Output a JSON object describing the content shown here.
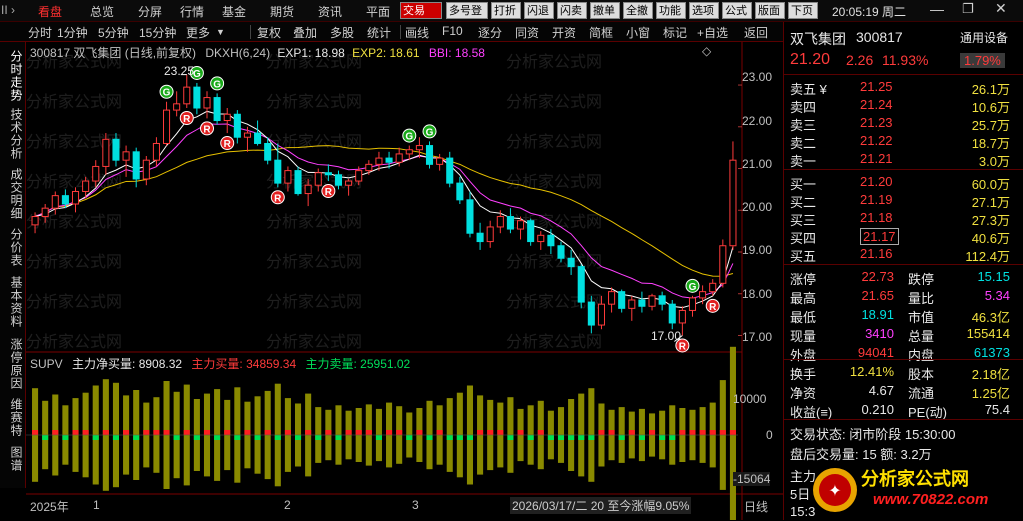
{
  "menubar": {
    "items": [
      "看盘",
      "总览",
      "分屏",
      "行情",
      "基金",
      "期货",
      "资讯",
      "平面"
    ],
    "active_index": 0,
    "partial_left": "II ›",
    "buttons": [
      "交易",
      "多号登",
      "打折",
      "闪退",
      "闪卖",
      "撤单",
      "全撤",
      "功能",
      "选项",
      "公式",
      "版面",
      "下页"
    ],
    "clock": "20:05:19 周二"
  },
  "toolbar": {
    "periods": [
      "分时",
      "1分钟",
      "5分钟",
      "15分钟",
      "更多"
    ],
    "actions": [
      "复权",
      "叠加",
      "多股",
      "统计",
      "画线",
      "F10",
      "逐分",
      "同资",
      "开资",
      "简框",
      "小窗",
      "标记",
      "+自选",
      "返回"
    ]
  },
  "leftnav": [
    "分时走势",
    "技术分析",
    "成交明细",
    "分价表",
    "基本资料",
    "涨停原因",
    "维赛特",
    "图谱"
  ],
  "legend_main": {
    "code_name": "300817 双飞集团 (日线,前复权)",
    "indicator": "DKXH(6,24)",
    "exp1": "EXP1: 18.98",
    "exp2": "EXP2: 18.61",
    "bbi": "BBI: 18.58"
  },
  "legend_sub": {
    "name": "SUPV",
    "net": "主力净买量: 8908.32",
    "buy": "主力买量: 34859.34",
    "sell": "主力卖量: 25951.02"
  },
  "annotations": {
    "high": "23.25",
    "low": "17.00"
  },
  "xaxis": {
    "labels": [
      "2025年",
      "1",
      "2",
      "3"
    ],
    "cursor_date": "2026/03/17/二",
    "range_text": "20 至今涨幅9.05%",
    "cycle": "日线"
  },
  "right_axis_main": [
    "23.00",
    "22.00",
    "21.00",
    "20.00",
    "19.00",
    "18.00",
    "17.00"
  ],
  "right_axis_sub": [
    "10000",
    "0",
    "-15064"
  ],
  "chart_data": {
    "type": "candlestick",
    "ylim": [
      16.7,
      23.6
    ],
    "ohlc": [
      [
        19.65,
        19.95,
        19.45,
        19.85
      ],
      [
        19.85,
        20.15,
        19.7,
        20.05
      ],
      [
        20.05,
        20.45,
        19.9,
        20.35
      ],
      [
        20.35,
        20.5,
        20.05,
        20.15
      ],
      [
        20.15,
        20.55,
        19.95,
        20.45
      ],
      [
        20.45,
        20.8,
        20.3,
        20.7
      ],
      [
        20.7,
        21.2,
        20.55,
        21.05
      ],
      [
        21.05,
        21.85,
        20.85,
        21.7
      ],
      [
        21.7,
        21.85,
        21.05,
        21.2
      ],
      [
        21.2,
        21.55,
        20.8,
        21.4
      ],
      [
        21.4,
        21.5,
        20.55,
        20.75
      ],
      [
        20.75,
        21.3,
        20.6,
        21.2
      ],
      [
        21.2,
        21.75,
        21.05,
        21.6
      ],
      [
        21.6,
        22.6,
        21.55,
        22.4
      ],
      [
        22.4,
        22.85,
        22.25,
        22.55
      ],
      [
        22.55,
        23.25,
        22.45,
        22.95
      ],
      [
        22.95,
        23.05,
        22.3,
        22.45
      ],
      [
        22.45,
        22.85,
        22.2,
        22.7
      ],
      [
        22.7,
        22.8,
        22.05,
        22.15
      ],
      [
        22.15,
        22.45,
        21.85,
        22.3
      ],
      [
        22.3,
        22.4,
        21.6,
        21.75
      ],
      [
        21.75,
        22.0,
        21.4,
        21.85
      ],
      [
        21.85,
        22.15,
        21.55,
        21.6
      ],
      [
        21.6,
        21.75,
        21.1,
        21.2
      ],
      [
        21.2,
        21.6,
        20.55,
        20.65
      ],
      [
        20.65,
        21.05,
        20.45,
        20.95
      ],
      [
        20.95,
        21.05,
        20.35,
        20.4
      ],
      [
        20.4,
        20.75,
        20.1,
        20.6
      ],
      [
        20.6,
        21.0,
        20.45,
        20.9
      ],
      [
        20.9,
        21.1,
        20.7,
        20.85
      ],
      [
        20.85,
        20.95,
        20.5,
        20.6
      ],
      [
        20.6,
        20.75,
        20.35,
        20.7
      ],
      [
        20.7,
        21.05,
        20.6,
        20.95
      ],
      [
        20.95,
        21.2,
        20.85,
        21.1
      ],
      [
        21.1,
        21.4,
        20.95,
        21.25
      ],
      [
        21.25,
        21.4,
        21.0,
        21.15
      ],
      [
        21.15,
        21.5,
        21.05,
        21.35
      ],
      [
        21.35,
        21.55,
        21.2,
        21.45
      ],
      [
        21.45,
        21.75,
        21.25,
        21.55
      ],
      [
        21.55,
        21.65,
        21.0,
        21.1
      ],
      [
        21.1,
        21.35,
        20.95,
        21.25
      ],
      [
        21.25,
        21.4,
        20.55,
        20.65
      ],
      [
        20.65,
        20.8,
        20.15,
        20.25
      ],
      [
        20.25,
        20.45,
        19.35,
        19.45
      ],
      [
        19.45,
        19.7,
        19.05,
        19.25
      ],
      [
        19.25,
        19.75,
        19.1,
        19.6
      ],
      [
        19.6,
        20.0,
        19.45,
        19.85
      ],
      [
        19.85,
        20.05,
        19.45,
        19.55
      ],
      [
        19.55,
        19.85,
        19.3,
        19.75
      ],
      [
        19.75,
        19.8,
        19.15,
        19.25
      ],
      [
        19.25,
        19.5,
        19.05,
        19.4
      ],
      [
        19.4,
        19.55,
        18.95,
        19.15
      ],
      [
        19.15,
        19.25,
        18.75,
        18.85
      ],
      [
        18.85,
        19.05,
        18.45,
        18.65
      ],
      [
        18.65,
        18.7,
        17.65,
        17.8
      ],
      [
        17.8,
        17.95,
        17.05,
        17.25
      ],
      [
        17.25,
        17.95,
        17.15,
        17.75
      ],
      [
        17.75,
        18.15,
        17.55,
        18.05
      ],
      [
        18.05,
        18.1,
        17.55,
        17.65
      ],
      [
        17.65,
        17.95,
        17.35,
        17.85
      ],
      [
        17.85,
        18.05,
        17.55,
        17.7
      ],
      [
        17.7,
        18.0,
        17.6,
        17.95
      ],
      [
        17.95,
        18.05,
        17.6,
        17.75
      ],
      [
        17.75,
        17.85,
        17.15,
        17.3
      ],
      [
        17.3,
        17.7,
        17.0,
        17.6
      ],
      [
        17.6,
        17.95,
        17.45,
        17.9
      ],
      [
        17.9,
        18.2,
        17.75,
        18.05
      ],
      [
        18.05,
        18.35,
        17.95,
        18.25
      ],
      [
        18.25,
        19.3,
        18.15,
        19.15
      ],
      [
        19.15,
        21.65,
        19.05,
        21.2
      ]
    ],
    "volume": [
      52,
      38,
      45,
      33,
      41,
      47,
      55,
      62,
      58,
      44,
      50,
      36,
      42,
      60,
      48,
      56,
      40,
      46,
      51,
      39,
      53,
      37,
      43,
      49,
      57,
      41,
      35,
      46,
      31,
      28,
      33,
      27,
      30,
      34,
      29,
      36,
      32,
      25,
      30,
      38,
      33,
      41,
      47,
      55,
      44,
      39,
      36,
      42,
      29,
      33,
      38,
      27,
      31,
      40,
      46,
      52,
      35,
      28,
      31,
      26,
      29,
      24,
      27,
      33,
      30,
      28,
      31,
      36,
      61,
      98
    ],
    "net_buy": [
      0.55,
      -0.4,
      0.6,
      -0.35,
      0.5,
      0.45,
      -0.55,
      0.7,
      -0.6,
      0.3,
      -0.4,
      0.35,
      0.5,
      0.65,
      -0.45,
      0.6,
      -0.5,
      0.4,
      -0.45,
      0.3,
      -0.55,
      0.35,
      -0.3,
      0.4,
      -0.6,
      0.45,
      -0.35,
      0.3,
      -0.25,
      0.2,
      -0.3,
      0.25,
      0.2,
      0.3,
      -0.25,
      0.3,
      0.25,
      -0.2,
      0.2,
      -0.35,
      0.3,
      -0.4,
      -0.45,
      -0.55,
      0.35,
      0.3,
      0.25,
      -0.3,
      0.2,
      -0.25,
      0.3,
      -0.2,
      -0.25,
      -0.35,
      -0.45,
      -0.5,
      0.3,
      0.25,
      -0.2,
      0.2,
      -0.25,
      0.2,
      -0.2,
      -0.3,
      0.25,
      0.2,
      0.25,
      0.3,
      0.6,
      0.9
    ],
    "signals": [
      {
        "type": "G",
        "at": 13
      },
      {
        "type": "R",
        "at": 15
      },
      {
        "type": "G",
        "at": 16
      },
      {
        "type": "R",
        "at": 17
      },
      {
        "type": "G",
        "at": 18
      },
      {
        "type": "R",
        "at": 19
      },
      {
        "type": "R",
        "at": 24
      },
      {
        "type": "R",
        "at": 29
      },
      {
        "type": "G",
        "at": 37
      },
      {
        "type": "G",
        "at": 39
      },
      {
        "type": "R",
        "at": 64
      },
      {
        "type": "G",
        "at": 65
      },
      {
        "type": "R",
        "at": 67
      }
    ]
  },
  "stock": {
    "name": "双飞集团",
    "code": "300817",
    "badge": "通用设备",
    "price": "21.20",
    "change": "2.26",
    "pct": "11.93%",
    "pct_badge": "1.79%"
  },
  "orderbook": {
    "asks": [
      [
        "卖五",
        "¥",
        "21.25",
        "26.1万"
      ],
      [
        "卖四",
        "",
        "21.24",
        "10.6万"
      ],
      [
        "卖三",
        "",
        "21.23",
        "25.7万"
      ],
      [
        "卖二",
        "",
        "21.22",
        "18.7万"
      ],
      [
        "卖一",
        "",
        "21.21",
        "3.0万"
      ]
    ],
    "bids": [
      [
        "买一",
        "21.20",
        "60.0万"
      ],
      [
        "买二",
        "21.19",
        "27.1万"
      ],
      [
        "买三",
        "21.18",
        "27.3万"
      ],
      [
        "买四",
        "21.17",
        "40.6万"
      ],
      [
        "买五",
        "21.16",
        "112.4万"
      ]
    ]
  },
  "stats": [
    [
      "涨停",
      "22.73",
      "跌停",
      "15.15"
    ],
    [
      "最高",
      "21.65",
      "量比",
      "5.34"
    ],
    [
      "最低",
      "18.91",
      "市值",
      "46.3亿"
    ],
    [
      "现量",
      "3410",
      "总量",
      "155414"
    ],
    [
      "外盘",
      "94041",
      "内盘",
      "61373"
    ]
  ],
  "stats2": [
    [
      "换手",
      "12.41%",
      "股本",
      "2.18亿"
    ],
    [
      "净资",
      "4.67",
      "流通",
      "1.25亿"
    ],
    [
      "收益(≡)",
      "0.210",
      "PE(动)",
      "75.4"
    ]
  ],
  "trade_status": "交易状态: 闭市阶段 15:30:00",
  "after_hours": "盘后交易量: 15  额: 3.2万",
  "bottom_partial": [
    "主力",
    "5日",
    "15:3"
  ],
  "watermark": {
    "text": "分析家公式网",
    "url": "www.70822.com"
  }
}
